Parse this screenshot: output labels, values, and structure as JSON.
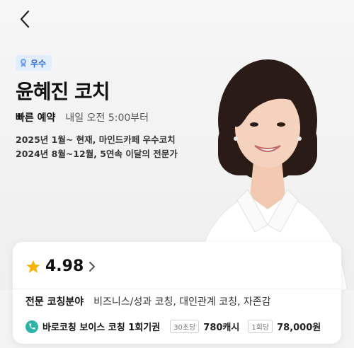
{
  "header": {
    "back_icon": "chevron-left-icon"
  },
  "coach": {
    "badge": "우수",
    "badge_icon": "medal-icon",
    "name": "윤혜진 코치",
    "quick_booking_label": "빠른 예약",
    "quick_booking_time": "내일 오전 5:00부터",
    "history": [
      "2025년 1월~ 현재, 마인드카페 우수코치",
      "2024년 8월~12월, 5연속 이달의 전문가"
    ]
  },
  "card": {
    "rating": "4.98",
    "field_label": "전문 코칭분야",
    "field_value": "비즈니스/성과 코칭, 대인관계 코칭, 자존감",
    "product_name": "바로코칭 보이스 코칭 1회기권",
    "tag1": "30초당",
    "price1": "780캐시",
    "tag2": "1회당",
    "price2": "78,000원"
  },
  "colors": {
    "accent_blue": "#2f6fd6",
    "badge_bg": "#e3eefc",
    "star": "#f5b301",
    "phone_icon_bg": "#2fb3a6"
  }
}
